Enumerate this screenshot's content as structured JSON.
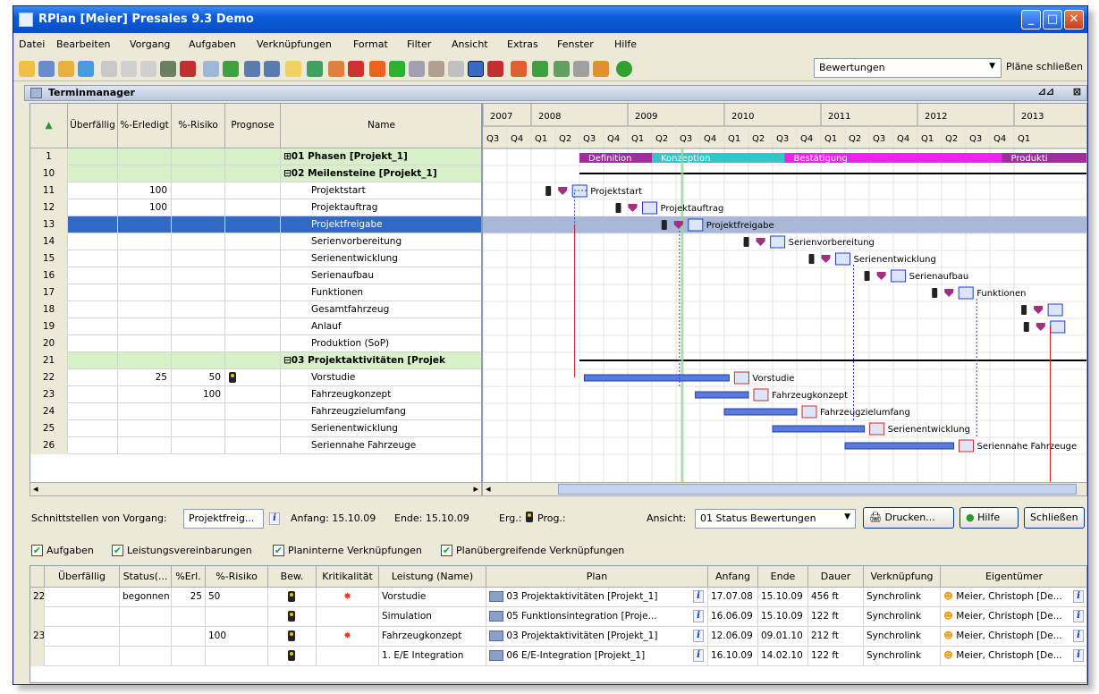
{
  "window": {
    "title": "RPlan [Meier] Presales 9.3 Demo",
    "min": "_",
    "max": "□",
    "close": "✕"
  },
  "menu": [
    "Datei",
    "Bearbeiten",
    "Vorgang",
    "Aufgaben",
    "Verknüpfungen",
    "Format",
    "Filter",
    "Ansicht",
    "Extras",
    "Fenster",
    "Hilfe"
  ],
  "toolbar": {
    "rating_select": "Bewertungen",
    "close_plans": "Pläne schließen"
  },
  "panel": {
    "title": "Terminmanager"
  },
  "grid": {
    "headers": [
      "Überfällig",
      "%-Erledigt",
      "%-Risiko",
      "Prognose",
      "Name"
    ],
    "rows": [
      {
        "n": "1",
        "name": "⊞01 Phasen [Projekt_1]",
        "g": true,
        "o": "",
        "e": "",
        "r": "",
        "p": false
      },
      {
        "n": "10",
        "name": "⊟02 Meilensteine [Projekt_1]",
        "g": true,
        "o": "",
        "e": "",
        "r": "",
        "p": false
      },
      {
        "n": "11",
        "name": "Projektstart",
        "g": false,
        "o": "",
        "e": "100",
        "r": "",
        "p": false
      },
      {
        "n": "12",
        "name": "Projektauftrag",
        "g": false,
        "o": "",
        "e": "100",
        "r": "",
        "p": false
      },
      {
        "n": "13",
        "name": "Projektfreigabe",
        "g": false,
        "s": true,
        "o": "",
        "e": "",
        "r": "",
        "p": false
      },
      {
        "n": "14",
        "name": "Serienvorbereitung",
        "g": false,
        "o": "",
        "e": "",
        "r": "",
        "p": false
      },
      {
        "n": "15",
        "name": "Serienentwicklung",
        "g": false,
        "o": "",
        "e": "",
        "r": "",
        "p": false
      },
      {
        "n": "16",
        "name": "Serienaufbau",
        "g": false,
        "o": "",
        "e": "",
        "r": "",
        "p": false
      },
      {
        "n": "17",
        "name": "Funktionen",
        "g": false,
        "o": "",
        "e": "",
        "r": "",
        "p": false
      },
      {
        "n": "18",
        "name": "Gesamtfahrzeug",
        "g": false,
        "o": "",
        "e": "",
        "r": "",
        "p": false
      },
      {
        "n": "19",
        "name": "Anlauf",
        "g": false,
        "o": "",
        "e": "",
        "r": "",
        "p": false
      },
      {
        "n": "20",
        "name": "Produktion (SoP)",
        "g": false,
        "o": "",
        "e": "",
        "r": "",
        "p": false
      },
      {
        "n": "21",
        "name": "⊟03 Projektaktivitäten [Projek",
        "g": true,
        "o": "",
        "e": "",
        "r": "",
        "p": false
      },
      {
        "n": "22",
        "name": "Vorstudie",
        "g": false,
        "o": "",
        "e": "25",
        "r": "50",
        "p": true
      },
      {
        "n": "23",
        "name": "Fahrzeugkonzept",
        "g": false,
        "o": "",
        "e": "",
        "r": "100",
        "p": false
      },
      {
        "n": "24",
        "name": "Fahrzeugzielumfang",
        "g": false,
        "o": "",
        "e": "",
        "r": "",
        "p": false
      },
      {
        "n": "25",
        "name": "Serienentwicklung",
        "g": false,
        "o": "",
        "e": "",
        "r": "",
        "p": false
      },
      {
        "n": "26",
        "name": "Seriennahe Fahrzeuge",
        "g": false,
        "o": "",
        "e": "",
        "r": "",
        "p": false
      }
    ]
  },
  "gantt": {
    "years": [
      "2007",
      "2008",
      "2009",
      "2010",
      "2011",
      "2012",
      "2013"
    ],
    "quarters": [
      "Q3",
      "Q4",
      "Q1",
      "Q2",
      "Q3",
      "Q4",
      "Q1",
      "Q2",
      "Q3",
      "Q4",
      "Q1",
      "Q2",
      "Q3",
      "Q4",
      "Q1",
      "Q2",
      "Q3",
      "Q4",
      "Q1",
      "Q2",
      "Q3",
      "Q4",
      "Q1"
    ],
    "phases": [
      {
        "label": "Definition",
        "color": "#9b2f9b"
      },
      {
        "label": "Konzeption",
        "color": "#2ec8c8"
      },
      {
        "label": "Bestätigung",
        "color": "#f020f0"
      },
      {
        "label": "Produkti",
        "color": "#9b2f9b"
      }
    ],
    "labels": [
      "Projektstart",
      "Projektauftrag",
      "Projektfreigabe",
      "Serienvorbereitung",
      "Serienentwicklung",
      "Serienaufbau",
      "Funktionen",
      "Vorstudie",
      "Fahrzeugkonzept",
      "Fahrzeugzielumfang",
      "Serienentwicklung",
      "Seriennahe Fahrzeuge"
    ]
  },
  "interface": {
    "label": "Schnittstellen von Vorgang:",
    "vorgang": "Projektfreig...",
    "anfang": "Anfang: 15.10.09",
    "ende": "Ende: 15.10.09",
    "erg": "Erg.:",
    "prog": "Prog.:",
    "ansicht_label": "Ansicht:",
    "ansicht": "01 Status Bewertungen",
    "drucken": "Drucken...",
    "hilfe": "Hilfe",
    "schliessen": "Schließen"
  },
  "checks": [
    "Aufgaben",
    "Leistungsvereinbarungen",
    "Planinterne Verknüpfungen",
    "Planübergreifende Verknüpfungen"
  ],
  "bottom": {
    "headers": [
      "Überfällig",
      "Status(...",
      "%Erl.",
      "%-Risiko",
      "Bew.",
      "Kritikalität",
      "Leistung (Name)",
      "Plan",
      "Anfang",
      "Ende",
      "Dauer",
      "Verknüpfung",
      "Eigentümer"
    ],
    "rows": [
      {
        "n": "22",
        "status": "begonnen",
        "erl": "25",
        "risk": "50",
        "bew": true,
        "krit": true,
        "leistung": "Vorstudie",
        "plan": "03 Projektaktivitäten [Projekt_1]",
        "anfang": "17.07.08",
        "ende": "15.10.09",
        "dauer": "456 ft",
        "link": "Synchrolink",
        "owner": "Meier, Christoph [De..."
      },
      {
        "n": "",
        "status": "",
        "erl": "",
        "risk": "",
        "bew": true,
        "krit": false,
        "leistung": "Simulation",
        "plan": "05 Funktionsintegration [Proje...",
        "anfang": "16.06.09",
        "ende": "15.10.09",
        "dauer": "122 ft",
        "link": "Synchrolink",
        "owner": "Meier, Christoph [De..."
      },
      {
        "n": "23",
        "status": "",
        "erl": "",
        "risk": "100",
        "bew": true,
        "krit": true,
        "leistung": "Fahrzeugkonzept",
        "plan": "03 Projektaktivitäten [Projekt_1]",
        "anfang": "12.06.09",
        "ende": "09.01.10",
        "dauer": "212 ft",
        "link": "Synchrolink",
        "owner": "Meier, Christoph [De..."
      },
      {
        "n": "",
        "status": "",
        "erl": "",
        "risk": "",
        "bew": true,
        "krit": false,
        "leistung": "1. E/E Integration",
        "plan": "06 E/E-Integration [Projekt_1]",
        "anfang": "16.10.09",
        "ende": "14.02.10",
        "dauer": "122 ft",
        "link": "Synchrolink",
        "owner": "Meier, Christoph [De..."
      }
    ]
  }
}
